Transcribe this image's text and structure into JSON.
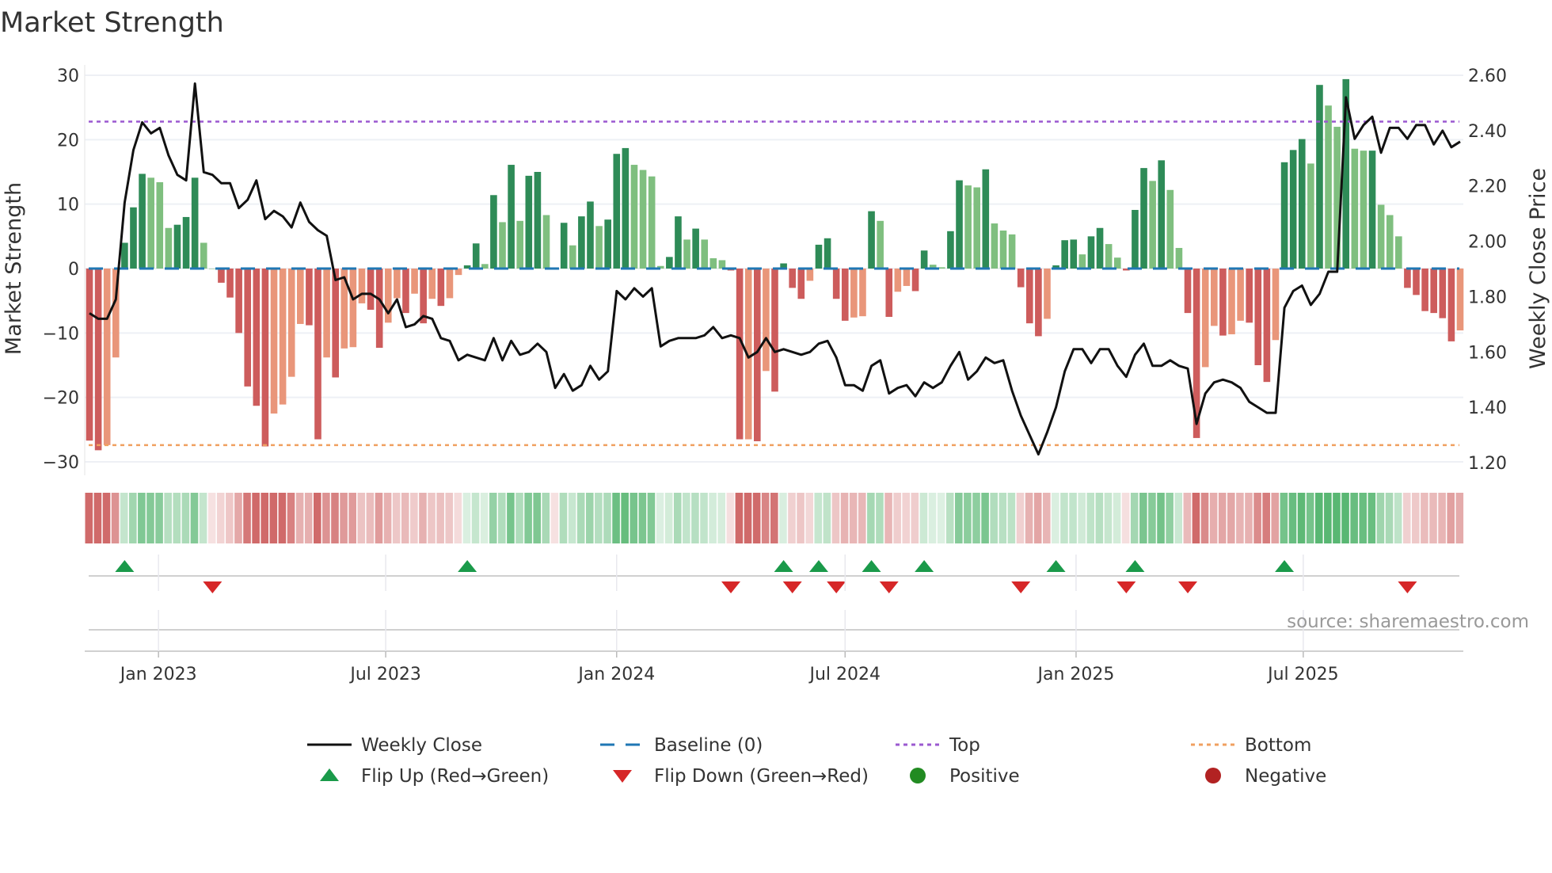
{
  "title": "Market Strength",
  "source": "source: sharemaestro.com",
  "chart_data": {
    "type": "bar",
    "title": "Market Strength",
    "x_start": "2022-11-07",
    "x_interval_days": 7,
    "ylabel": "Market Strength",
    "ylabel_right": "Weekly Close Price",
    "ylim": [
      -30,
      30
    ],
    "ylim_right": [
      1.2,
      2.6
    ],
    "yticks": [
      "30",
      "20",
      "10",
      "0",
      "−10",
      "−20",
      "−30"
    ],
    "yticks_right": [
      "2.60",
      "2.40",
      "2.20",
      "2.00",
      "1.80",
      "1.60",
      "1.40",
      "1.20"
    ],
    "xticks": [
      {
        "label": "Jan 2023",
        "date": "2023-01-01"
      },
      {
        "label": "Jul 2023",
        "date": "2023-07-01"
      },
      {
        "label": "Jan 2024",
        "date": "2024-01-01"
      },
      {
        "label": "Jul 2024",
        "date": "2024-07-01"
      },
      {
        "label": "Jan 2025",
        "date": "2025-01-01"
      },
      {
        "label": "Jul 2025",
        "date": "2025-07-01"
      }
    ],
    "top_level": 22.8,
    "bottom_level": -27.4,
    "baseline": 0,
    "strength": [
      -26.7,
      -28.2,
      -27.4,
      -13.8,
      4,
      9.5,
      14.7,
      14.1,
      13.4,
      6.3,
      6.8,
      8.0,
      14.1,
      4.0,
      0,
      -2.2,
      -4.5,
      -10,
      -18.3,
      -21.3,
      -27.6,
      -22.5,
      -21.1,
      -16.8,
      -8.6,
      -8.8,
      -26.5,
      -13.8,
      -16.9,
      -12.4,
      -12.2,
      -5.4,
      -6.4,
      -12.3,
      -8.4,
      -4.6,
      -6.9,
      -3.9,
      -8.5,
      -4.7,
      -5.8,
      -4.6,
      -1.0,
      0.5,
      3.9,
      0.7,
      11.4,
      7.2,
      16.1,
      7.4,
      14.4,
      15.0,
      8.3,
      0,
      7.1,
      3.6,
      8.1,
      10.4,
      6.6,
      7.6,
      17.8,
      18.7,
      16.1,
      15.3,
      14.3,
      0.4,
      1.8,
      8.1,
      4.5,
      6.2,
      4.5,
      1.6,
      1.3,
      -0.3,
      -26.5,
      -26.5,
      -26.8,
      -15.9,
      -19.1,
      0.8,
      -3.0,
      -4.7,
      -1.9,
      3.7,
      4.7,
      -4.7,
      -8.1,
      -7.6,
      -7.4,
      8.9,
      7.4,
      -7.5,
      -3.6,
      -2.7,
      -3.5,
      2.8,
      0.6,
      0.2,
      5.8,
      13.7,
      12.9,
      12.6,
      15.4,
      7.0,
      5.9,
      5.3,
      -2.9,
      -8.5,
      -10.5,
      -7.8,
      0.5,
      4.4,
      4.5,
      2.2,
      5.0,
      6.3,
      3.8,
      1.7,
      -0.3,
      9.1,
      15.6,
      13.6,
      16.8,
      12.2,
      3.2,
      -6.9,
      -26.3,
      -15.3,
      -8.9,
      -10.4,
      -10.2,
      -8.1,
      -8.4,
      -15,
      -17.6,
      -11.1,
      16.5,
      18.4,
      20.1,
      16.3,
      28.5,
      25.3,
      22,
      29.4,
      18.6,
      18.3,
      18.3,
      9.9,
      8.3,
      5.0,
      -3,
      -4.1,
      -6.6,
      -6.9,
      -7.7,
      -11.3,
      -9.6
    ],
    "strong": [
      1,
      1,
      0,
      0,
      1,
      1,
      1,
      0,
      0,
      0,
      1,
      1,
      1,
      0,
      0,
      1,
      1,
      1,
      1,
      1,
      1,
      0,
      0,
      0,
      0,
      1,
      1,
      0,
      1,
      0,
      0,
      0,
      1,
      1,
      0,
      0,
      1,
      0,
      1,
      0,
      1,
      0,
      0,
      1,
      1,
      0,
      1,
      0,
      1,
      0,
      1,
      1,
      0,
      0,
      1,
      0,
      1,
      1,
      0,
      1,
      1,
      1,
      0,
      0,
      0,
      0,
      1,
      1,
      0,
      1,
      0,
      0,
      0,
      1,
      1,
      0,
      1,
      0,
      1,
      1,
      1,
      1,
      0,
      1,
      1,
      1,
      1,
      0,
      0,
      1,
      0,
      1,
      0,
      0,
      1,
      1,
      0,
      0,
      1,
      1,
      0,
      0,
      1,
      0,
      0,
      0,
      1,
      1,
      1,
      0,
      1,
      1,
      1,
      0,
      1,
      1,
      0,
      0,
      1,
      1,
      1,
      0,
      1,
      0,
      0,
      1,
      1,
      0,
      0,
      1,
      0,
      0,
      1,
      1,
      1,
      0,
      1,
      1,
      1,
      0,
      1,
      0,
      0,
      1,
      0,
      0,
      1,
      0,
      0,
      0,
      1,
      1,
      1,
      1,
      1,
      1,
      0
    ],
    "weekly_close": [
      1.74,
      1.72,
      1.72,
      1.79,
      2.14,
      2.33,
      2.43,
      2.39,
      2.41,
      2.31,
      2.24,
      2.22,
      2.57,
      2.25,
      2.24,
      2.21,
      2.21,
      2.12,
      2.15,
      2.22,
      2.08,
      2.11,
      2.09,
      2.05,
      2.14,
      2.07,
      2.04,
      2.02,
      1.86,
      1.87,
      1.79,
      1.81,
      1.81,
      1.79,
      1.74,
      1.79,
      1.69,
      1.7,
      1.73,
      1.72,
      1.65,
      1.64,
      1.57,
      1.59,
      1.58,
      1.57,
      1.65,
      1.57,
      1.64,
      1.59,
      1.6,
      1.63,
      1.6,
      1.47,
      1.52,
      1.46,
      1.48,
      1.55,
      1.5,
      1.53,
      1.82,
      1.79,
      1.83,
      1.8,
      1.83,
      1.62,
      1.64,
      1.65,
      1.65,
      1.65,
      1.66,
      1.69,
      1.65,
      1.66,
      1.65,
      1.58,
      1.6,
      1.65,
      1.6,
      1.61,
      1.6,
      1.59,
      1.6,
      1.63,
      1.64,
      1.58,
      1.48,
      1.48,
      1.46,
      1.55,
      1.57,
      1.45,
      1.47,
      1.48,
      1.44,
      1.49,
      1.47,
      1.49,
      1.55,
      1.6,
      1.5,
      1.53,
      1.58,
      1.56,
      1.57,
      1.46,
      1.37,
      1.3,
      1.23,
      1.31,
      1.4,
      1.53,
      1.61,
      1.61,
      1.56,
      1.61,
      1.61,
      1.55,
      1.51,
      1.59,
      1.63,
      1.55,
      1.55,
      1.57,
      1.55,
      1.54,
      1.34,
      1.45,
      1.49,
      1.5,
      1.49,
      1.47,
      1.42,
      1.4,
      1.38,
      1.38,
      1.76,
      1.82,
      1.84,
      1.77,
      1.81,
      1.89,
      1.89,
      2.52,
      2.37,
      2.42,
      2.45,
      2.32,
      2.41,
      2.41,
      2.37,
      2.42,
      2.42,
      2.35,
      2.4,
      2.34,
      2.36
    ],
    "flip_up_weeks": [
      4,
      43,
      79,
      83,
      89,
      95,
      110,
      119,
      136
    ],
    "flip_down_weeks": [
      14,
      73,
      80,
      85,
      91,
      106,
      118,
      125,
      150
    ],
    "legend": [
      {
        "label": "Weekly Close",
        "kind": "line",
        "color": "#111111"
      },
      {
        "label": "Baseline (0)",
        "kind": "dash",
        "color": "#1f77b4"
      },
      {
        "label": "Top",
        "kind": "dot",
        "color": "#9b59d0"
      },
      {
        "label": "Bottom",
        "kind": "dot",
        "color": "#f0a060"
      },
      {
        "label": "Flip Up (Red→Green)",
        "kind": "up",
        "color": "#1a9a4a"
      },
      {
        "label": "Flip Down (Green→Red)",
        "kind": "down",
        "color": "#d62728"
      },
      {
        "label": "Positive",
        "kind": "circle",
        "color": "#228b22"
      },
      {
        "label": "Negative",
        "kind": "circle",
        "color": "#b22222"
      }
    ],
    "legend_position": "bottom",
    "colors": {
      "pos_strong": "#2e8b57",
      "pos_weak": "#7fbf7f",
      "neg_strong": "#cd5c5c",
      "neg_weak": "#e9967a",
      "baseline": "#1f77b4",
      "top": "#9b59d0",
      "bottom": "#f0a060",
      "close": "#111111",
      "flip_up": "#1a9a4a",
      "flip_down": "#d62728"
    }
  }
}
